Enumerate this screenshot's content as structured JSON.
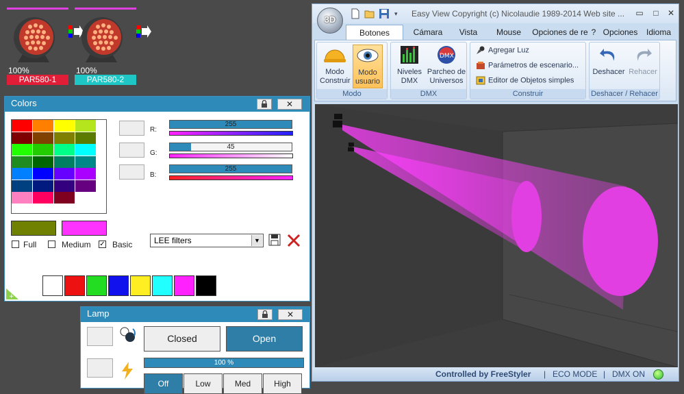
{
  "fixtures": [
    {
      "percent": "100%",
      "label": "PAR580-1",
      "label_color": "#e21d38"
    },
    {
      "percent": "100%",
      "label": "PAR580-2",
      "label_color": "#1fc6c6"
    }
  ],
  "colors_panel": {
    "title": "Colors",
    "lock_icon": "lock-icon",
    "close_label": "✕",
    "rgb": {
      "r_label": "R:",
      "r_value": "255",
      "r_fraction": 1.0,
      "g_label": "G:",
      "g_value": "45",
      "g_fraction": 0.176,
      "b_label": "B:",
      "b_value": "255",
      "b_fraction": 1.0
    },
    "current_color": "#708000",
    "selected_color": "#ff33ff",
    "checks": [
      {
        "label": "Full",
        "checked": false
      },
      {
        "label": "Medium",
        "checked": false
      },
      {
        "label": "Basic",
        "checked": true
      }
    ],
    "filter_select": "LEE filters",
    "palette": [
      "#ff0000",
      "#ff8000",
      "#ffff00",
      "#b5e61d",
      "#7f0000",
      "#804000",
      "#808000",
      "#5a7a00",
      "#22ff00",
      "#22cc00",
      "#00ff88",
      "#00ffff",
      "#1e8c1e",
      "#006600",
      "#008060",
      "#008888",
      "#0080ff",
      "#0000ff",
      "#6600ff",
      "#aa00ff",
      "#004080",
      "#001a80",
      "#330080",
      "#660080",
      "#ff80c0",
      "#ff0060",
      "#800020",
      "#ffffff"
    ],
    "basic_colors": [
      "#ffffff",
      "#ee1111",
      "#22dd22",
      "#1111ee",
      "#ffee22",
      "#22ffff",
      "#ff22ff",
      "#000000"
    ]
  },
  "lamp_panel": {
    "title": "Lamp",
    "close_label": "✕",
    "closed_label": "Closed",
    "open_label": "Open",
    "intensity_value": "100 %",
    "intensity_fraction": 1.0,
    "buttons": [
      "Off",
      "Low",
      "Med",
      "High"
    ]
  },
  "window": {
    "title": "Easy View  Copyright (c) Nicolaudie 1989-2014   Web site ...",
    "logo": "3D",
    "tabs": [
      "Botones estánd",
      "Cámara",
      "Vista",
      "Mouse",
      "Opciones de re",
      "?",
      "Opciones",
      "Idioma"
    ],
    "groups": {
      "modo": {
        "label": "Modo",
        "construir": "Modo Construir",
        "usuario": "Modo usuario"
      },
      "dmx": {
        "label": "DMX",
        "niveles": "Niveles DMX",
        "parcheo": "Parcheo de Universos"
      },
      "construir": {
        "label": "Construir",
        "agregar": "Agregar Luz",
        "parametros": "Parámetros de escenario...",
        "editor": "Editor de Objetos simples"
      },
      "deshacer": {
        "label": "Deshacer / Rehacer",
        "deshacer": "Deshacer",
        "rehacer": "Rehacer"
      }
    },
    "status": {
      "controlled": "Controlled by FreeStyler",
      "sep": "|",
      "eco": "ECO MODE",
      "dmx": "DMX ON"
    }
  }
}
